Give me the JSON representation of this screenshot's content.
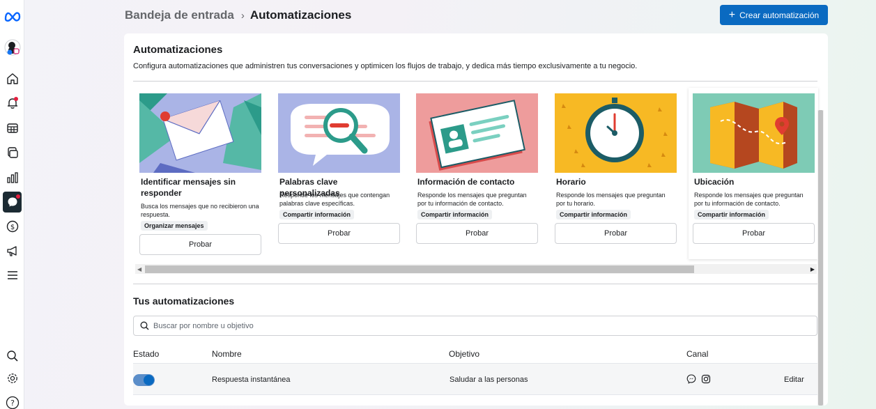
{
  "header": {
    "breadcrumb_parent": "Bandeja de entrada",
    "breadcrumb_current": "Automatizaciones",
    "create_button": "Crear automatización"
  },
  "nav": {
    "items": [
      {
        "icon": "meta-logo-icon"
      },
      {
        "icon": "account-avatar-icon"
      },
      {
        "icon": "home-icon"
      },
      {
        "icon": "notifications-bell-icon",
        "badge": true
      },
      {
        "icon": "table-icon"
      },
      {
        "icon": "content-icon"
      },
      {
        "icon": "insights-chart-icon"
      },
      {
        "icon": "inbox-chat-icon",
        "active": true,
        "badge": true
      },
      {
        "icon": "monetization-dollar-icon"
      },
      {
        "icon": "ads-megaphone-icon"
      },
      {
        "icon": "menu-icon"
      },
      {
        "icon": "search-icon"
      },
      {
        "icon": "settings-gear-icon"
      },
      {
        "icon": "help-icon"
      }
    ]
  },
  "intro": {
    "title": "Automatizaciones",
    "subtitle": "Configura automatizaciones que administren tus conversaciones y optimicen los flujos de trabajo, y dedica más tiempo exclusivamente a tu negocio."
  },
  "cards": [
    {
      "title": "Identificar mensajes sin responder",
      "desc": "Busca los mensajes que no recibieron una respuesta.",
      "tag": "Organizar mensajes",
      "button": "Probar"
    },
    {
      "title": "Palabras clave personalizadas",
      "desc": "Responde los mensajes que contengan palabras clave específicas.",
      "tag": "Compartir información",
      "button": "Probar"
    },
    {
      "title": "Información de contacto",
      "desc": "Responde los mensajes que preguntan por tu información de contacto.",
      "tag": "Compartir información",
      "button": "Probar"
    },
    {
      "title": "Horario",
      "desc": "Responde los mensajes que preguntan por tu horario.",
      "tag": "Compartir información",
      "button": "Probar"
    },
    {
      "title": "Ubicación",
      "desc": "Responde los mensajes que preguntan por tu información de contacto.",
      "tag": "Compartir información",
      "button": "Probar"
    }
  ],
  "automations": {
    "title": "Tus automatizaciones",
    "search_placeholder": "Buscar por nombre u objetivo",
    "columns": [
      "Estado",
      "Nombre",
      "Objetivo",
      "Canal"
    ],
    "rows": [
      {
        "enabled": true,
        "name": "Respuesta instantánea",
        "goal": "Saludar a las personas",
        "channels": [
          "messenger-icon",
          "instagram-icon"
        ],
        "action": "Editar"
      }
    ]
  },
  "colors": {
    "primary": "#0a6ac1",
    "badge": "#e41e3f",
    "active_nav": "#1c2b33"
  }
}
